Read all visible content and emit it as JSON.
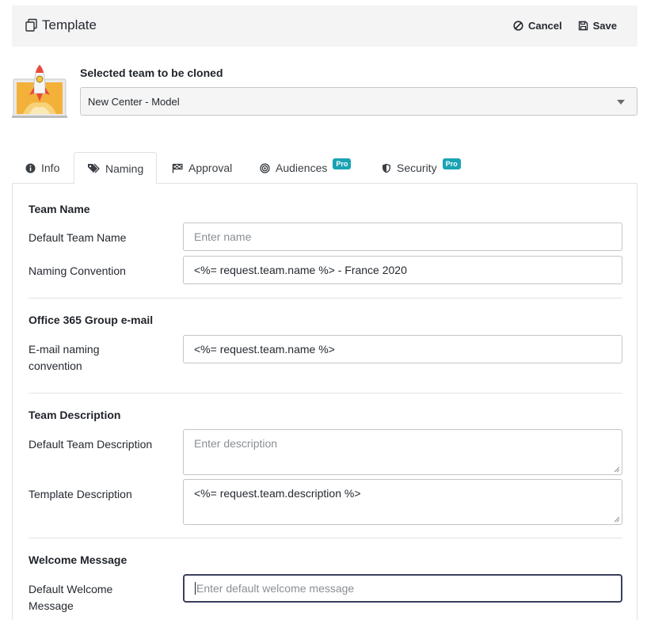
{
  "header": {
    "title": "Template",
    "cancel_label": "Cancel",
    "save_label": "Save"
  },
  "clone": {
    "label": "Selected team to be cloned",
    "selected_value": "New Center - Model"
  },
  "tabs": [
    {
      "label": "Info",
      "icon": "info-icon",
      "active": false
    },
    {
      "label": "Naming",
      "icon": "tags-icon",
      "active": true
    },
    {
      "label": "Approval",
      "icon": "flag-icon",
      "active": false
    },
    {
      "label": "Audiences",
      "icon": "target-icon",
      "badge": "Pro",
      "active": false
    },
    {
      "label": "Security",
      "icon": "shield-icon",
      "badge": "Pro",
      "active": false
    }
  ],
  "sections": {
    "team_name": {
      "title": "Team Name",
      "default_label": "Default Team Name",
      "default_placeholder": "Enter name",
      "convention_label": "Naming Convention",
      "convention_value": "<%= request.team.name %> - France 2020"
    },
    "group_email": {
      "title": "Office 365 Group e-mail",
      "label": "E-mail naming convention",
      "value": "<%= request.team.name %>"
    },
    "description": {
      "title": "Team Description",
      "default_label": "Default Team Description",
      "default_placeholder": "Enter description",
      "template_label": "Template Description",
      "template_value": "<%= request.team.description %>"
    },
    "welcome": {
      "title": "Welcome Message",
      "label": "Default Welcome Message",
      "placeholder": "Enter default welcome message"
    }
  },
  "colors": {
    "header_bg": "#f4f4f5",
    "pro_badge": "#19a3b4",
    "focus_border": "#3b3f5c"
  }
}
